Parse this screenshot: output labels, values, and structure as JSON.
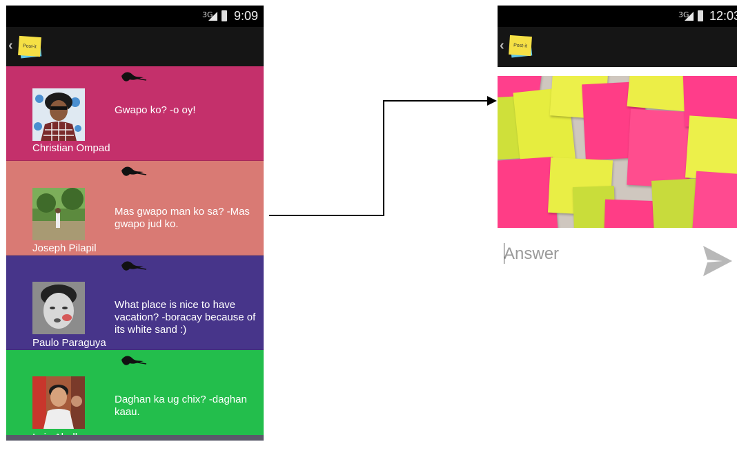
{
  "left_screen": {
    "status": {
      "network": "3G",
      "time": "9:09"
    },
    "logo_text": "Post-it",
    "posts": [
      {
        "question": "Gwapo ko? -o oy!",
        "author": "Christian Ompad",
        "color": "#c4306b"
      },
      {
        "question": "Mas gwapo man ko sa? -Mas gwapo jud ko.",
        "author": "Joseph Pilapil",
        "color": "#d97a74"
      },
      {
        "question": "What place is nice to have vacation? -boracay because of its white sand :)",
        "author": "Paulo Paraguya",
        "color": "#47358a"
      },
      {
        "question": "Daghan ka ug chix? -daghan kaau.",
        "author": "Irvin Abellanosa",
        "color": "#23be4c"
      }
    ]
  },
  "right_screen": {
    "status": {
      "network": "3G",
      "time": "12:03"
    },
    "logo_text": "Post-it",
    "answer_placeholder": "Answer"
  }
}
